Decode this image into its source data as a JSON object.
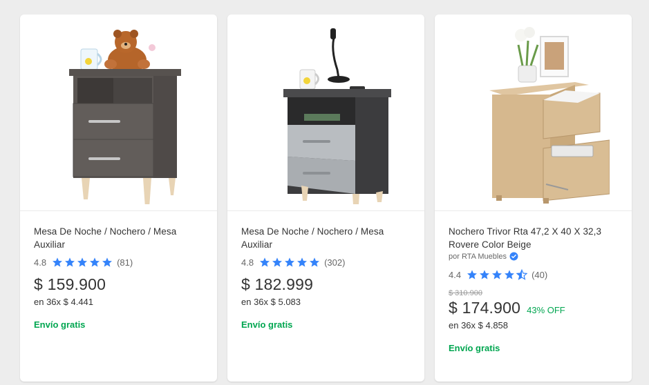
{
  "products": [
    {
      "title": "Mesa De Noche / Nochero / Mesa Auxiliar",
      "image_icon": "nightstand-dark-wood-with-teddy-bear",
      "rating": "4.8",
      "stars": 5,
      "reviews": "(81)",
      "price": "$ 159.900",
      "installments": "en 36x $ 4.441",
      "shipping": "Envío gratis"
    },
    {
      "title": "Mesa De Noche / Nochero / Mesa Auxiliar",
      "image_icon": "nightstand-gray-with-lamp",
      "rating": "4.8",
      "stars": 5,
      "reviews": "(302)",
      "price": "$ 182.999",
      "installments": "en 36x $ 5.083",
      "shipping": "Envío gratis"
    },
    {
      "title": "Nochero Trivor Rta 47,2 X 40 X 32,3 Rovere Color Beige",
      "image_icon": "nightstand-beige-open-drawers",
      "seller": "por RTA Muebles",
      "rating": "4.4",
      "stars": 4.5,
      "reviews": "(40)",
      "original_price": "$ 310.900",
      "price": "$ 174.900",
      "discount": "43% OFF",
      "installments": "en 36x $ 4.858",
      "shipping": "Envío gratis"
    }
  ],
  "colors": {
    "star": "#3483fa",
    "shipping": "#00a650",
    "discount": "#00a650",
    "background": "#ededed"
  }
}
